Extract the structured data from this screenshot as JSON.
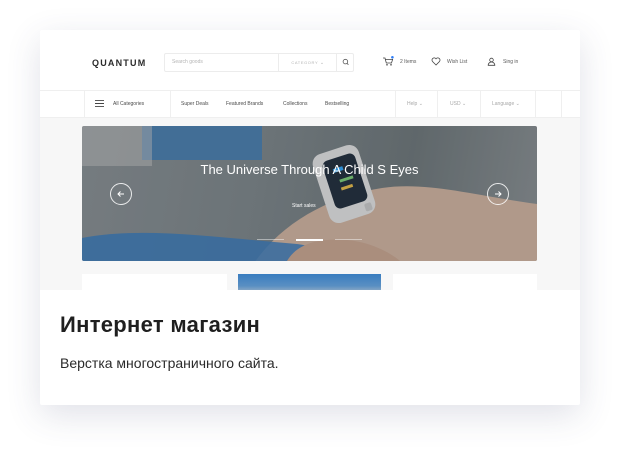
{
  "card": {
    "title": "Интернет магазин",
    "subtitle": "Верстка многостраничного сайта."
  },
  "site": {
    "logo": "QUANTUM",
    "search": {
      "placeholder": "Search goods",
      "category_label": "CATEGORY"
    },
    "header": {
      "cart_label": "2 Items",
      "wishlist_label": "Wish List",
      "signin_label": "Sing in"
    },
    "nav": {
      "all_categories": "All Categories",
      "items": [
        "Super Deals",
        "Featured Brands",
        "Collections",
        "Bestselling"
      ],
      "help": "Help",
      "currency": "USD",
      "language": "Language"
    },
    "hero": {
      "title": "The Universe Through A Child S Eyes",
      "link": "Start sales",
      "slide_count": 3,
      "active_slide": 2
    }
  },
  "colors": {
    "accent": "#2f7df6",
    "text": "#1f1f1f"
  }
}
